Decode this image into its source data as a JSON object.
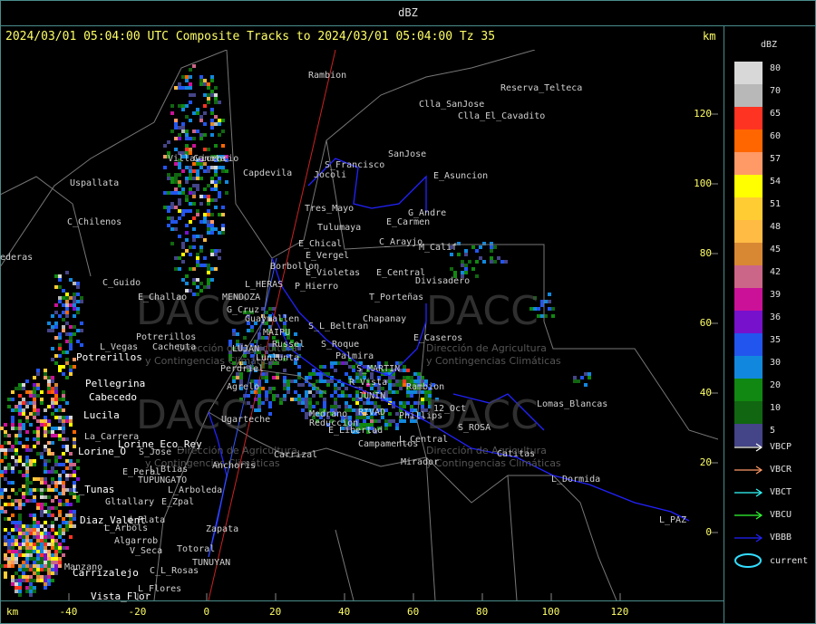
{
  "window": {
    "title": "dBZ"
  },
  "header": {
    "text": "2024/03/01 05:04:00 UTC Composite Tracks to 2024/03/01 05:04:00 Tz 35",
    "km_label": "km"
  },
  "legend": {
    "title": "dBZ",
    "items": [
      {
        "label": "80",
        "color": "#d8d8d8"
      },
      {
        "label": "70",
        "color": "#b8b8b8"
      },
      {
        "label": "65",
        "color": "#ff3322"
      },
      {
        "label": "60",
        "color": "#ff6600"
      },
      {
        "label": "57",
        "color": "#ff9966"
      },
      {
        "label": "54",
        "color": "#ffff00"
      },
      {
        "label": "51",
        "color": "#ffcc33"
      },
      {
        "label": "48",
        "color": "#ffbb44"
      },
      {
        "label": "45",
        "color": "#d88833"
      },
      {
        "label": "42",
        "color": "#cc6688"
      },
      {
        "label": "39",
        "color": "#cc1199"
      },
      {
        "label": "36",
        "color": "#7711cc"
      },
      {
        "label": "35",
        "color": "#2255ee"
      },
      {
        "label": "30",
        "color": "#1188dd"
      },
      {
        "label": "20",
        "color": "#118811"
      },
      {
        "label": "10",
        "color": "#116611"
      },
      {
        "label": "5",
        "color": "#444488"
      }
    ],
    "tracks": [
      {
        "label": "VBCP",
        "color": "#ffffff"
      },
      {
        "label": "VBCR",
        "color": "#ff9966"
      },
      {
        "label": "VBCT",
        "color": "#33ffff"
      },
      {
        "label": "VBCU",
        "color": "#33ff33"
      },
      {
        "label": "VBBB",
        "color": "#2222ff"
      }
    ],
    "current_label": "current",
    "current_color": "#33ddff"
  },
  "axes": {
    "x_unit": "km",
    "y_unit": "km",
    "x_ticks": [
      -40,
      -20,
      0,
      20,
      40,
      60,
      80,
      100,
      120
    ],
    "y_ticks": [
      120,
      100,
      80,
      60,
      40,
      20,
      0
    ],
    "y_tick_labels": [
      "120",
      "100",
      "80",
      "60",
      "40",
      "20",
      "0"
    ],
    "x_tick_labels": [
      "-40",
      "-20",
      "0",
      "20",
      "40",
      "60",
      "80",
      "100",
      "120"
    ]
  },
  "places": [
    {
      "name": "Rambion",
      "bright": false
    },
    {
      "name": "Reserva_Telteca",
      "bright": false
    },
    {
      "name": "Clla_SanJose",
      "bright": false
    },
    {
      "name": "Clla_El_Cavadito",
      "bright": false
    },
    {
      "name": "SanJose",
      "bright": false
    },
    {
      "name": "Villavicencio",
      "bright": false
    },
    {
      "name": "Canota",
      "bright": false
    },
    {
      "name": "Capdevila",
      "bright": false
    },
    {
      "name": "S_Francisco",
      "bright": false
    },
    {
      "name": "Jocoli",
      "bright": false
    },
    {
      "name": "E_Asuncion",
      "bright": false
    },
    {
      "name": "Uspallata",
      "bright": false
    },
    {
      "name": "Tres_Mayo",
      "bright": false
    },
    {
      "name": "G_Andre",
      "bright": false
    },
    {
      "name": "E_Carmen",
      "bright": false
    },
    {
      "name": "C_Chilenos",
      "bright": false
    },
    {
      "name": "Tulumaya",
      "bright": false
    },
    {
      "name": "E_Chical",
      "bright": false
    },
    {
      "name": "C_Arayjo",
      "bright": false
    },
    {
      "name": "M_Calif",
      "bright": false
    },
    {
      "name": "E_Vergel",
      "bright": false
    },
    {
      "name": "ederas",
      "bright": false
    },
    {
      "name": "Borbollon",
      "bright": false
    },
    {
      "name": "E_Central",
      "bright": false
    },
    {
      "name": "E_Violetas",
      "bright": false
    },
    {
      "name": "Divisadero",
      "bright": false
    },
    {
      "name": "C_Guido",
      "bright": false
    },
    {
      "name": "MENDOZA",
      "bright": false
    },
    {
      "name": "L_HERAS",
      "bright": false
    },
    {
      "name": "P_Hierro",
      "bright": false
    },
    {
      "name": "E_Challao",
      "bright": false
    },
    {
      "name": "T_Porteñas",
      "bright": false
    },
    {
      "name": "G_Cruz",
      "bright": false
    },
    {
      "name": "Chapanay",
      "bright": false
    },
    {
      "name": "Guaymallen",
      "bright": false
    },
    {
      "name": "MAIPU",
      "bright": false
    },
    {
      "name": "S_L_Beltran",
      "bright": false
    },
    {
      "name": "Potrerillos",
      "bright": false
    },
    {
      "name": "L_Vegas",
      "bright": false
    },
    {
      "name": "Cacheuta",
      "bright": false
    },
    {
      "name": "Russel",
      "bright": false
    },
    {
      "name": "LUJAN",
      "bright": false
    },
    {
      "name": "S_Roque",
      "bright": false
    },
    {
      "name": "Palmira",
      "bright": false
    },
    {
      "name": "E_Caseros",
      "bright": false
    },
    {
      "name": "Lunlunta",
      "bright": false
    },
    {
      "name": "Perdriel",
      "bright": false
    },
    {
      "name": "S_MARTIN",
      "bright": false
    },
    {
      "name": "Potrerillos",
      "bright": true
    },
    {
      "name": "Agrelo",
      "bright": false
    },
    {
      "name": "Pellegrina",
      "bright": true
    },
    {
      "name": "R_Vista",
      "bright": false
    },
    {
      "name": "Rambion",
      "bright": false
    },
    {
      "name": "Cabecedo",
      "bright": true
    },
    {
      "name": "JUNIN",
      "bright": false
    },
    {
      "name": "Lucila",
      "bright": true
    },
    {
      "name": "Medrano",
      "bright": false
    },
    {
      "name": "RIVAD",
      "bright": false
    },
    {
      "name": "Phillips",
      "bright": false
    },
    {
      "name": "12_Oct",
      "bright": false
    },
    {
      "name": "Lomas_Blancas",
      "bright": false
    },
    {
      "name": "Ugarteche",
      "bright": false
    },
    {
      "name": "Reduccion",
      "bright": false
    },
    {
      "name": "S_ROSA",
      "bright": false
    },
    {
      "name": "La_Carrera",
      "bright": false
    },
    {
      "name": "E_Libertad",
      "bright": false
    },
    {
      "name": "Lorine_Eco_Rey",
      "bright": true
    },
    {
      "name": "Lorine_O",
      "bright": true
    },
    {
      "name": "S_Jose",
      "bright": false
    },
    {
      "name": "Campamentos",
      "bright": false
    },
    {
      "name": "L_Central",
      "bright": false
    },
    {
      "name": "Carrizal",
      "bright": false
    },
    {
      "name": "Catitas",
      "bright": false
    },
    {
      "name": "Anchoris",
      "bright": false
    },
    {
      "name": "L_Btias",
      "bright": false
    },
    {
      "name": "E_Peral",
      "bright": false
    },
    {
      "name": "Mirador",
      "bright": false
    },
    {
      "name": "L_Dormida",
      "bright": false
    },
    {
      "name": "TUPUNGATO",
      "bright": false
    },
    {
      "name": "L_Tunas",
      "bright": true
    },
    {
      "name": "L_Arboleda",
      "bright": false
    },
    {
      "name": "Gltallary",
      "bright": false
    },
    {
      "name": "E_Zpal",
      "bright": false
    },
    {
      "name": "Diaz_Valent",
      "bright": true
    },
    {
      "name": "d_Plata",
      "bright": false
    },
    {
      "name": "L_Arbols",
      "bright": false
    },
    {
      "name": "Zapata",
      "bright": false
    },
    {
      "name": "L_PAZ",
      "bright": false
    },
    {
      "name": "Algarrob",
      "bright": false
    },
    {
      "name": "V_Seca",
      "bright": false
    },
    {
      "name": "Totoral",
      "bright": false
    },
    {
      "name": "Manzano",
      "bright": false
    },
    {
      "name": "TUNUYAN",
      "bright": false
    },
    {
      "name": "Carrizalejo",
      "bright": true
    },
    {
      "name": "C_L_Rosas",
      "bright": false
    },
    {
      "name": "L_Flores",
      "bright": false
    },
    {
      "name": "Vista_Flor",
      "bright": true
    }
  ],
  "watermark": {
    "brand": "DACC",
    "subtitle_1": "Dirección de Agricultura",
    "subtitle_2": "y Contingencias Climáticas"
  }
}
